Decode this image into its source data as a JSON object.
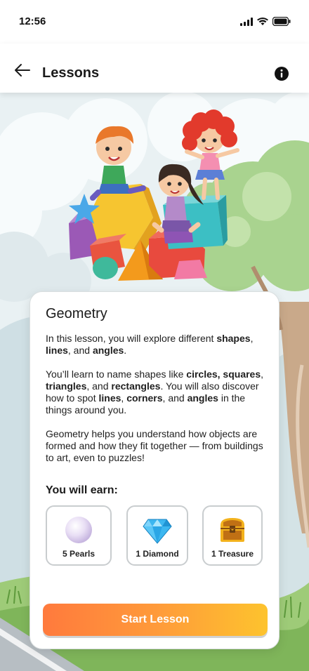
{
  "status": {
    "time": "12:56"
  },
  "header": {
    "title": "Lessons"
  },
  "lesson": {
    "title": "Geometry",
    "intro": {
      "text_before": "In this lesson, you will explore different ",
      "strong_1": "shapes",
      "sep_1": ", ",
      "strong_2": "lines",
      "sep_2": ", and ",
      "strong_3": "angles",
      "text_after": "."
    },
    "learn": {
      "text_1": "You’ll learn to name shapes like ",
      "strong_1": "circles, squares",
      "sep_1": ", ",
      "strong_2": "triangles",
      "sep_2": ", and ",
      "strong_3": "rectangles",
      "text_2": ". You will also discover how to spot ",
      "strong_4": "lines",
      "sep_3": ", ",
      "strong_5": "corners",
      "sep_4": ", and ",
      "strong_6": "angles",
      "text_3": " in the things around you."
    },
    "summary": "Geometry helps you understand how objects are formed and how they fit together — from buildings to art, even to puzzles!",
    "earn_heading": "You will earn:",
    "rewards": [
      {
        "label": "5 Pearls",
        "icon": "pearl-icon"
      },
      {
        "label": "1 Diamond",
        "icon": "diamond-icon"
      },
      {
        "label": "1 Treasure",
        "icon": "treasure-chest-icon"
      }
    ],
    "start_label": "Start Lesson"
  },
  "colors": {
    "button_gradient_start": "#ff7a3d",
    "button_gradient_end": "#fdc32e"
  }
}
